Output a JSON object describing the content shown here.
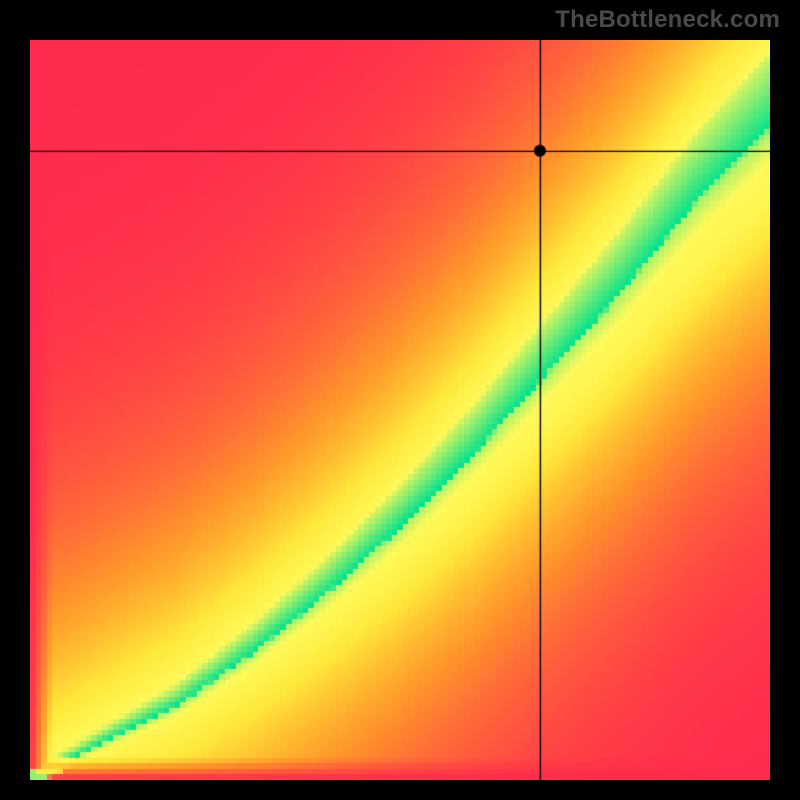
{
  "watermark": "TheBottleneck.com",
  "chart_data": {
    "type": "heatmap",
    "title": "",
    "xlabel": "",
    "ylabel": "",
    "x_range": [
      0,
      1
    ],
    "y_range": [
      0,
      1
    ],
    "marker": {
      "x": 0.69,
      "y": 0.85
    },
    "optimal_band": {
      "description": "Green band where configuration is balanced (y ≈ nonlinear function of x)",
      "center_curve": [
        {
          "x": 0.0,
          "y": 0.0
        },
        {
          "x": 0.1,
          "y": 0.05
        },
        {
          "x": 0.2,
          "y": 0.1
        },
        {
          "x": 0.3,
          "y": 0.17
        },
        {
          "x": 0.4,
          "y": 0.25
        },
        {
          "x": 0.5,
          "y": 0.34
        },
        {
          "x": 0.6,
          "y": 0.44
        },
        {
          "x": 0.7,
          "y": 0.55
        },
        {
          "x": 0.8,
          "y": 0.66
        },
        {
          "x": 0.9,
          "y": 0.78
        },
        {
          "x": 1.0,
          "y": 0.88
        }
      ],
      "half_width_at_x0": 0.01,
      "half_width_at_x1": 0.1
    },
    "color_stops": [
      {
        "t": 0.0,
        "color": "#ff2a4d"
      },
      {
        "t": 0.4,
        "color": "#ff9a2a"
      },
      {
        "t": 0.7,
        "color": "#ffe83a"
      },
      {
        "t": 0.88,
        "color": "#fff95a"
      },
      {
        "t": 1.0,
        "color": "#00e28e"
      }
    ],
    "marker_radius_px": 6,
    "crosshair": true
  }
}
